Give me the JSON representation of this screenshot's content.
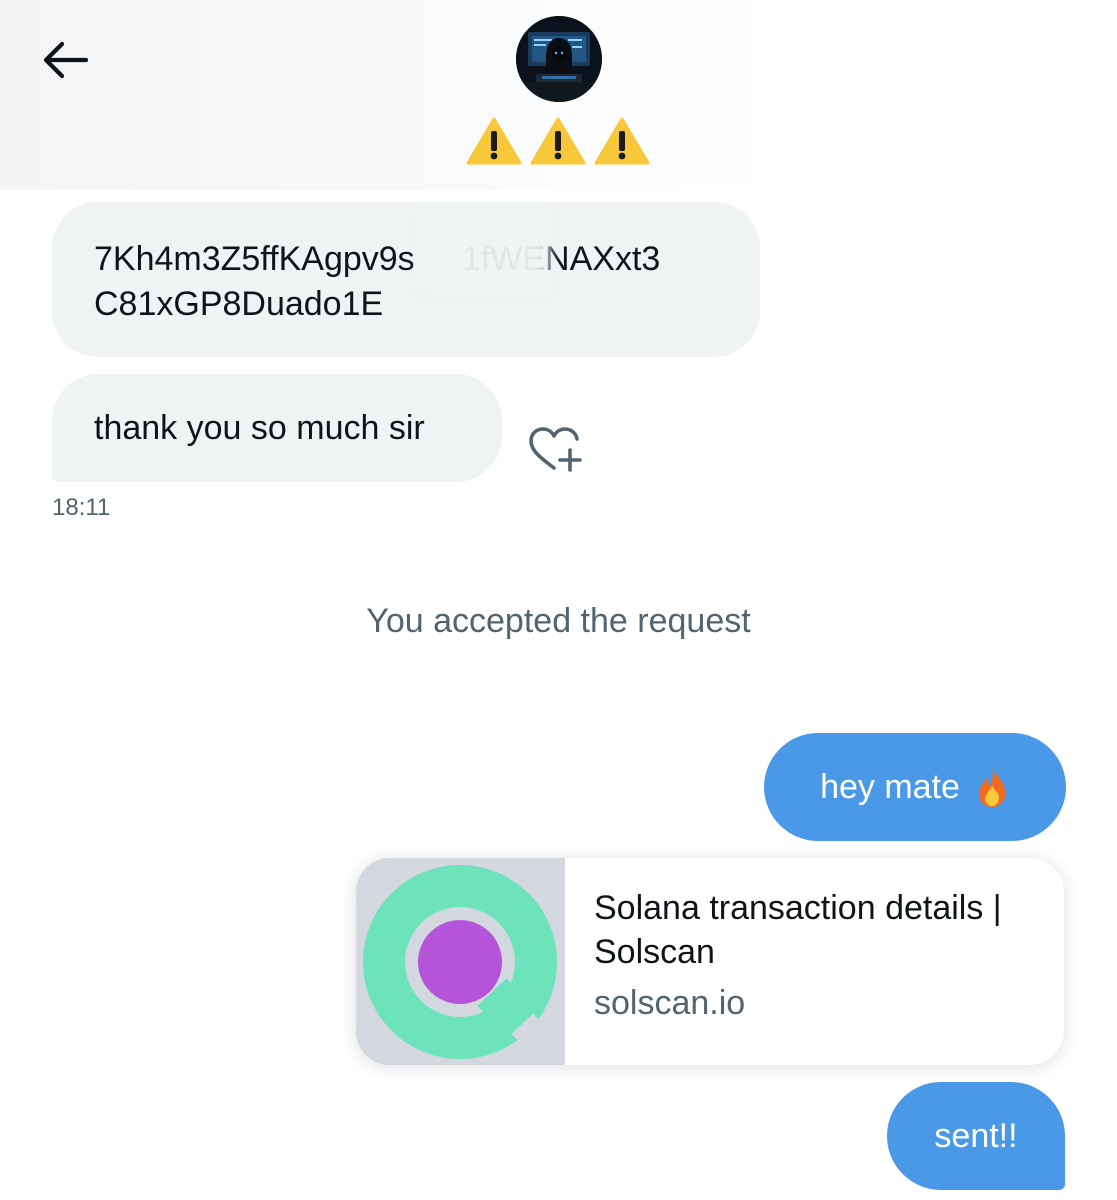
{
  "header": {
    "warning_icons": [
      "warning-icon",
      "warning-icon",
      "warning-icon"
    ]
  },
  "messages": {
    "address_line1": "7Kh4m3Z5ffKAgpv9s     1fWENAXxt3",
    "address_line2": "C81xGP8Duado1E",
    "thanks": "thank you so much sir",
    "timestamp": "18:11",
    "system": "You accepted the request",
    "hey": "hey mate",
    "sent": "sent!!"
  },
  "link_card": {
    "title": "Solana transaction details | Solscan",
    "domain": "solscan.io"
  },
  "colors": {
    "incoming_bubble": "#eff3f4",
    "outgoing_bubble": "#4a98e8",
    "secondary_text": "#536471",
    "solscan_green": "#6ce3ba",
    "solscan_purple": "#b554d9"
  }
}
